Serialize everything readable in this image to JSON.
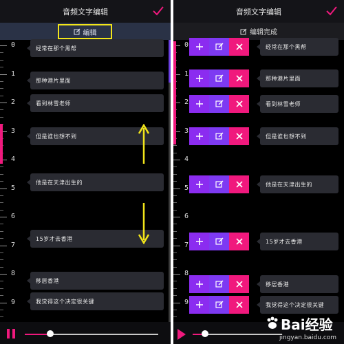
{
  "left": {
    "title": "音频文字编辑",
    "edit_label": "编辑",
    "ruler_labels": [
      "0",
      "1",
      "2",
      "3",
      "4",
      "5",
      "6",
      "7",
      "8",
      "9"
    ],
    "subtitles": [
      {
        "text": "经常在那个黑帮"
      },
      {
        "text": "那种港片里面"
      },
      {
        "text": "看到林雪老师"
      },
      {
        "text": "但是谁也想不到"
      },
      {
        "text": "他是在天津出生的"
      },
      {
        "text": "15岁才去香港"
      },
      {
        "text": "移居香港"
      },
      {
        "text": "我觉得这个决定很关键"
      }
    ]
  },
  "right": {
    "title": "音频文字编辑",
    "done_label": "编辑完成",
    "ruler_labels": [
      "0",
      "1",
      "2",
      "3",
      "4",
      "5",
      "6",
      "7",
      "8",
      "9"
    ],
    "subtitles": [
      {
        "text": "经常在那个黑帮"
      },
      {
        "text": "那种港片里面"
      },
      {
        "text": "看到林雪老师"
      },
      {
        "text": "但是谁也想不到"
      },
      {
        "text": "他是在天津出生的"
      },
      {
        "text": "15岁才去香港"
      },
      {
        "text": "移居香港"
      },
      {
        "text": "我觉得这个决定很关键"
      }
    ]
  },
  "watermark": {
    "text": "Bai经验",
    "url": "jingyan.baidu.com"
  },
  "colors": {
    "accent_pink": "#f0197d",
    "accent_purple": "#8b2cf0",
    "highlight_yellow": "#f2e51a"
  },
  "playback": {
    "progress_left": 0.19,
    "progress_right": 0.14
  }
}
